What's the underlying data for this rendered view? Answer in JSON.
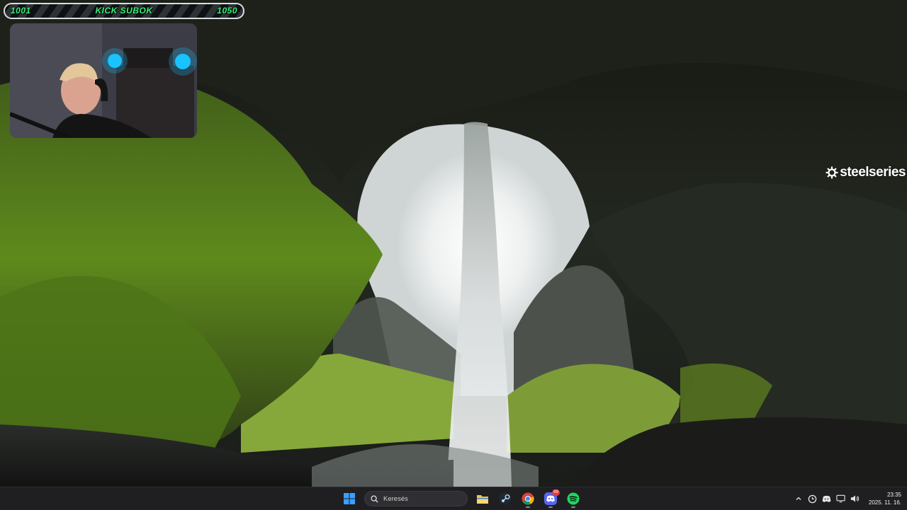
{
  "overlay": {
    "sub_goal": {
      "current": "1001",
      "title": "KICK SUBOK",
      "target": "1050"
    },
    "brand": "steelseries"
  },
  "taskbar": {
    "search_placeholder": "Keresés",
    "pinned": [
      {
        "icon": "windows-start-icon"
      },
      {
        "icon": "file-explorer-icon"
      },
      {
        "icon": "steam-icon"
      },
      {
        "icon": "chrome-icon"
      },
      {
        "icon": "discord-icon",
        "badge": "99"
      },
      {
        "icon": "spotify-icon"
      }
    ],
    "clock": {
      "time": "23:35",
      "date": "2025. 11. 16."
    },
    "tray_icons": [
      "chevron-up-icon",
      "steelseries-gg-icon",
      "discord-tray-icon",
      "network-icon",
      "volume-icon"
    ]
  }
}
